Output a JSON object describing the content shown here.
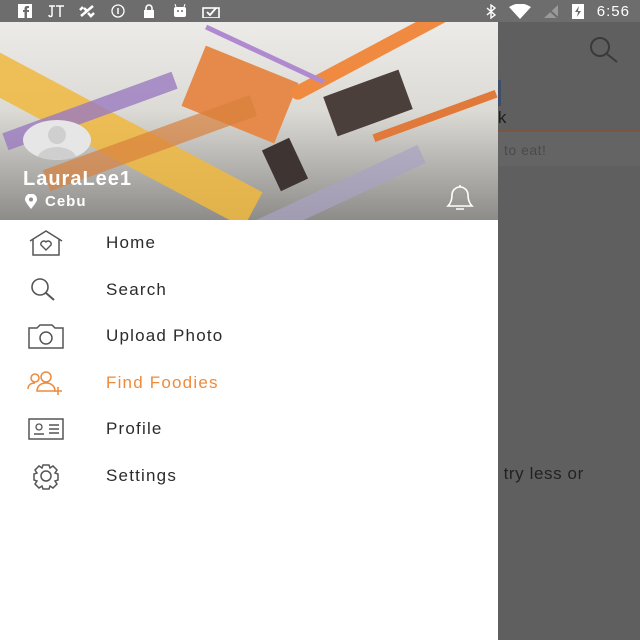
{
  "status_bar": {
    "time": "6:56",
    "icons": [
      "facebook-icon",
      "jt-icon",
      "satellite-icon",
      "info-icon",
      "lock-icon",
      "android-icon",
      "briefcase-icon",
      "bluetooth-icon",
      "wifi-icon",
      "no-sim-icon",
      "battery-charging-icon"
    ]
  },
  "background": {
    "tab_partial": "ook",
    "subtitle_partial": "to eat!",
    "body_partial": "r try less or"
  },
  "drawer": {
    "username": "LauraLee1",
    "location": "Cebu",
    "accent": "#ef8a3c",
    "menu": [
      {
        "label": "Home",
        "icon": "home-heart-icon"
      },
      {
        "label": "Search",
        "icon": "search-icon"
      },
      {
        "label": "Upload Photo",
        "icon": "camera-icon"
      },
      {
        "label": "Find Foodies",
        "icon": "add-friends-icon",
        "active": true
      },
      {
        "label": "Profile",
        "icon": "id-card-icon"
      },
      {
        "label": "Settings",
        "icon": "gear-icon"
      }
    ]
  }
}
